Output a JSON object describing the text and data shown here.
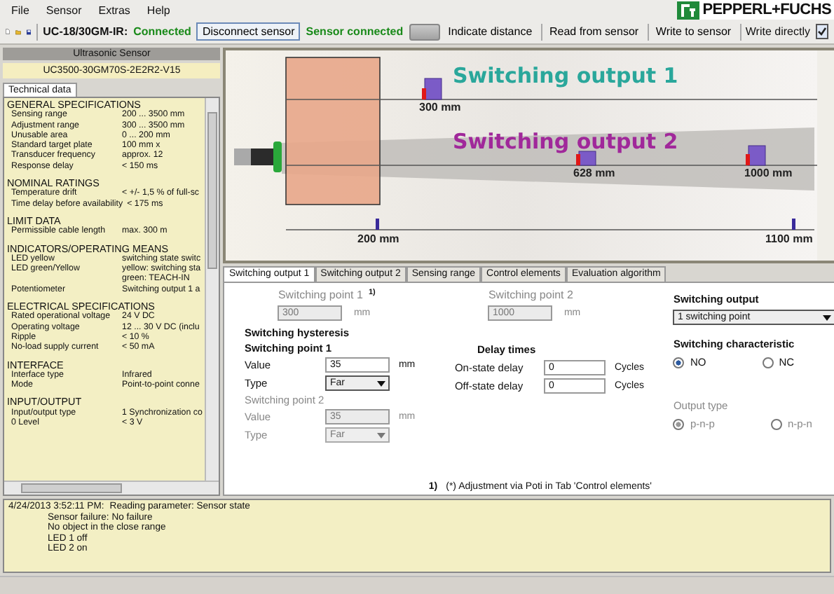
{
  "menu": [
    "File",
    "Sensor",
    "Extras",
    "Help"
  ],
  "logo": "PEPPERL+FUCHS",
  "toolbar": {
    "device": "UC-18/30GM-IR:",
    "connection_status": "Connected",
    "disconnect_button": "Disconnect sensor",
    "sensor_status": "Sensor connected",
    "buttons": [
      "Indicate distance",
      "Read from sensor",
      "Write to sensor"
    ],
    "write_directly": {
      "label": "Write directly",
      "checked": true
    }
  },
  "sidebar": {
    "header": "Ultrasonic Sensor",
    "model": "UC3500-30GM70S-2E2R2-V15",
    "tabs": [
      {
        "label": "Technical data",
        "selected": true
      }
    ],
    "sections": [
      {
        "title": "GENERAL SPECIFICATIONS",
        "rows": [
          {
            "label": "Sensing range",
            "values": [
              "200 ... 3500 mm"
            ]
          },
          {
            "label": "Adjustment range",
            "values": [
              "300 ... 3500 mm"
            ]
          },
          {
            "label": "Unusable area",
            "values": [
              "0 ... 200 mm"
            ]
          },
          {
            "label": "Standard target plate",
            "values": [
              "100 mm x"
            ]
          },
          {
            "label": "Transducer frequency",
            "values": [
              "approx. 12"
            ]
          },
          {
            "label": "Response delay",
            "values": [
              "< 150 ms"
            ]
          }
        ]
      },
      {
        "title": "NOMINAL RATINGS",
        "rows": [
          {
            "label": "Temperature drift",
            "values": [
              "< +/- 1,5 % of full-sc"
            ]
          },
          {
            "label": "Time delay before availability",
            "values": [
              "< 175 ms"
            ]
          }
        ]
      },
      {
        "title": "LIMIT DATA",
        "rows": [
          {
            "label": "Permissible cable length",
            "values": [
              "max. 300 m"
            ]
          }
        ]
      },
      {
        "title": "INDICATORS/OPERATING MEANS",
        "rows": [
          {
            "label": "LED yellow",
            "values": [
              "switching state switc"
            ]
          },
          {
            "label": "LED green/Yellow",
            "values": [
              "yellow: switching sta",
              "green: TEACH-IN"
            ]
          },
          {
            "label": "Potentiometer",
            "values": [
              "Switching output 1 a"
            ]
          }
        ]
      },
      {
        "title": "ELECTRICAL SPECIFICATIONS",
        "rows": [
          {
            "label": "Rated operational voltage",
            "values": [
              "24 V DC"
            ]
          },
          {
            "label": "Operating voltage",
            "values": [
              "12 ... 30 V DC (inclu"
            ]
          },
          {
            "label": "Ripple",
            "values": [
              "< 10 %"
            ]
          },
          {
            "label": "No-load supply current",
            "values": [
              "< 50 mA"
            ]
          }
        ]
      },
      {
        "title": "INTERFACE",
        "rows": [
          {
            "label": "Interface type",
            "values": [
              "Infrared"
            ]
          },
          {
            "label": "Mode",
            "values": [
              "Point-to-point conne"
            ]
          }
        ]
      },
      {
        "title": "INPUT/OUTPUT",
        "rows": [
          {
            "label": "Input/output type",
            "values": [
              "1 Synchronization co"
            ]
          },
          {
            "label": "0 Level",
            "values": [
              "< 3 V"
            ]
          }
        ]
      }
    ]
  },
  "visualization": {
    "outputs": [
      {
        "title": "Switching output 1",
        "color": "#2aa79b"
      },
      {
        "title": "Switching output 2",
        "color": "#a0289a"
      }
    ],
    "markers": [
      {
        "label": "300 mm",
        "kind": "output"
      },
      {
        "label": "628 mm",
        "kind": "output"
      },
      {
        "label": "1000 mm",
        "kind": "output"
      },
      {
        "label": "200 mm",
        "kind": "range"
      },
      {
        "label": "1100 mm",
        "kind": "range"
      }
    ]
  },
  "tabs": [
    {
      "label": "Switching output 1",
      "selected": true
    },
    {
      "label": "Switching output 2",
      "selected": false
    },
    {
      "label": "Sensing range",
      "selected": false
    },
    {
      "label": "Control elements",
      "selected": false
    },
    {
      "label": "Evaluation algorithm",
      "selected": false
    }
  ],
  "switching_points": [
    {
      "label": "Switching point 1",
      "mark": "1)",
      "value": "300",
      "unit": "mm",
      "disabled": true
    },
    {
      "label": "Switching point 2",
      "value": "1000",
      "unit": "mm",
      "disabled": true
    }
  ],
  "switching_output": {
    "label": "Switching output",
    "value": "1 switching point"
  },
  "hysteresis": {
    "title": "Switching hysteresis",
    "groups": [
      {
        "title": "Switching point 1",
        "disabled": false,
        "value_label": "Value",
        "value": "35",
        "unit": "mm",
        "type_label": "Type",
        "type": "Far"
      },
      {
        "title": "Switching point 2",
        "disabled": true,
        "value_label": "Value",
        "value": "35",
        "unit": "mm",
        "type_label": "Type",
        "type": "Far"
      }
    ]
  },
  "delay_times": {
    "title": "Delay times",
    "rows": [
      {
        "label": "On-state delay",
        "value": "0",
        "unit": "Cycles"
      },
      {
        "label": "Off-state delay",
        "value": "0",
        "unit": "Cycles"
      }
    ]
  },
  "switching_characteristic": {
    "title": "Switching characteristic",
    "disabled": false,
    "options": [
      {
        "label": "NO",
        "selected": true
      },
      {
        "label": "NC",
        "selected": false
      }
    ]
  },
  "output_type": {
    "title": "Output type",
    "disabled": true,
    "options": [
      {
        "label": "p-n-p",
        "selected": true
      },
      {
        "label": "n-p-n",
        "selected": false
      }
    ]
  },
  "footnote": {
    "mark": "1)",
    "text": "(*) Adjustment via Poti in Tab 'Control elements'"
  },
  "log": {
    "timestamp": "4/24/2013 3:52:11 PM:",
    "message": "Reading parameter: Sensor state",
    "details": [
      "Sensor failure: No failure",
      "No object in the close range",
      "LED 1 off",
      "LED 2 on"
    ]
  }
}
